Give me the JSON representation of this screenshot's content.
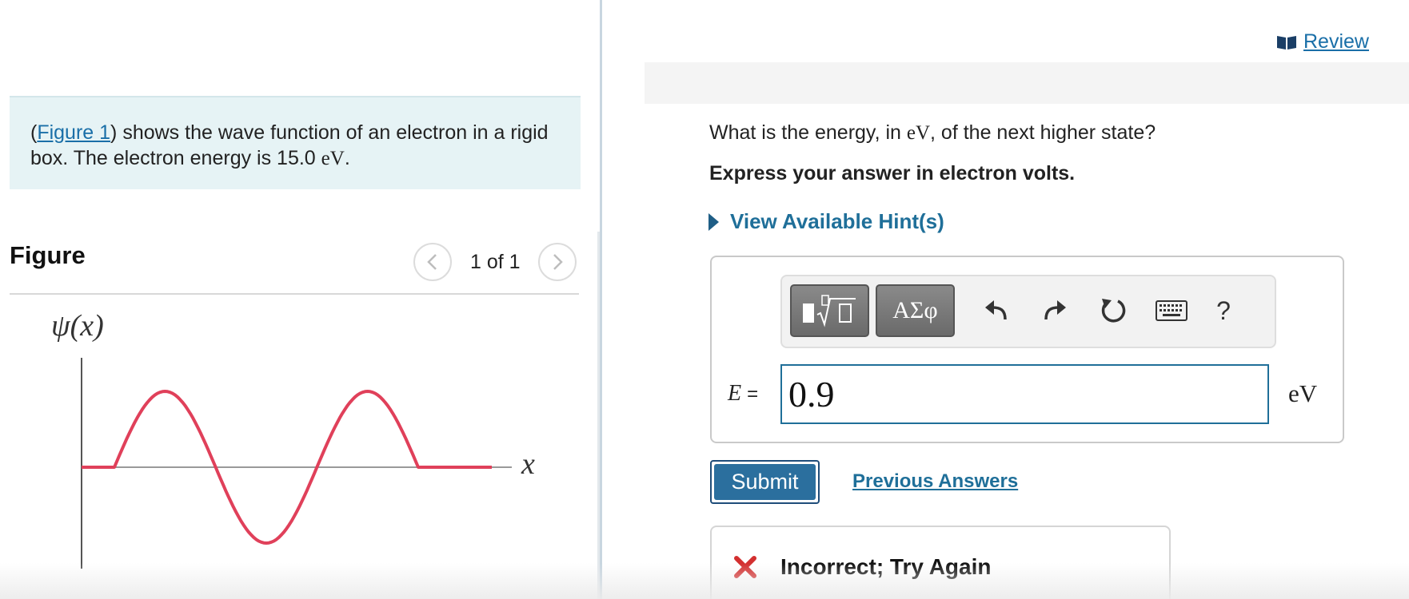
{
  "problem": {
    "link_text": "Figure 1",
    "text_a": "(",
    "text_b": ") shows the wave function of an electron in a rigid box. The electron energy is 15.0 ",
    "unit": "eV",
    "text_c": "."
  },
  "figure": {
    "heading": "Figure",
    "page_count": "1 of 1",
    "y_axis_label": "ψ(x)",
    "x_axis_label": "x",
    "wave_color": "#e0405a"
  },
  "review": {
    "label": "Review"
  },
  "question": {
    "text_a": "What is the energy, in ",
    "unit": "eV",
    "text_b": ", of the next higher state?",
    "instruction": "Express your answer in electron volts."
  },
  "hints": {
    "label": "View Available Hint(s)"
  },
  "answer": {
    "variable": "E",
    "equals": "=",
    "value": "0.9",
    "unit": "eV",
    "symbols_label": "ΑΣφ",
    "help_label": "?"
  },
  "actions": {
    "submit_label": "Submit",
    "previous_answers_label": "Previous Answers"
  },
  "feedback": {
    "text": "Incorrect; Try Again",
    "status_color": "#d32f2f"
  },
  "colors": {
    "accent": "#1f6f99",
    "problem_background": "#e6f3f5"
  }
}
